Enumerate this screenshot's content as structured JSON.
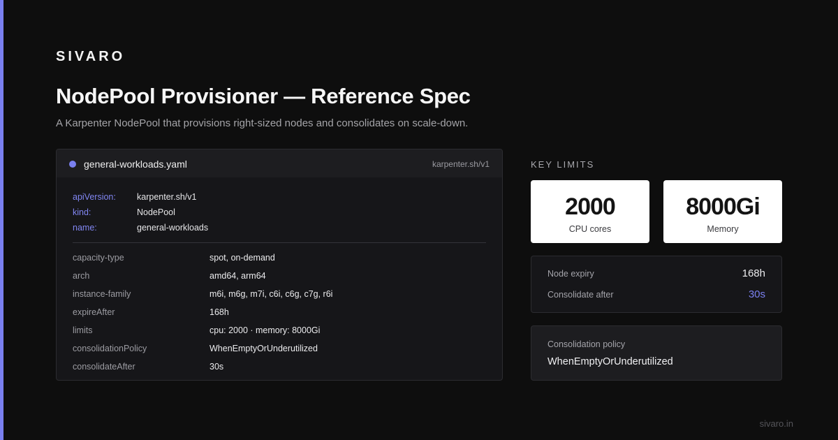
{
  "brand": "SIVARO",
  "title": "NodePool Provisioner — Reference Spec",
  "subtitle": "A Karpenter NodePool that provisions right-sized nodes and consolidates on scale-down.",
  "spec": {
    "file_name": "general-workloads.yaml",
    "api_tag": "karpenter.sh/v1",
    "meta": [
      {
        "key": "apiVersion:",
        "value": "karpenter.sh/v1"
      },
      {
        "key": "kind:",
        "value": "NodePool"
      },
      {
        "key": "name:",
        "value": "general-workloads"
      }
    ],
    "rows": [
      {
        "key": "capacity-type",
        "value": "spot, on-demand"
      },
      {
        "key": "arch",
        "value": "amd64, arm64"
      },
      {
        "key": "instance-family",
        "value": "m6i, m6g, m7i, c6i, c6g, c7g, r6i"
      },
      {
        "key": "expireAfter",
        "value": "168h"
      },
      {
        "key": "limits",
        "value": "cpu: 2000 · memory: 8000Gi"
      },
      {
        "key": "consolidationPolicy",
        "value": "WhenEmptyOrUnderutilized"
      },
      {
        "key": "consolidateAfter",
        "value": "30s"
      }
    ]
  },
  "limits": {
    "label": "KEY LIMITS",
    "stats": [
      {
        "value": "2000",
        "label": "CPU cores"
      },
      {
        "value": "8000Gi",
        "label": "Memory"
      }
    ],
    "info": [
      {
        "key": "Node expiry",
        "value": "168h"
      },
      {
        "key": "Consolidate after",
        "value": "30s"
      }
    ],
    "policy_label": "Consolidation policy",
    "policy_value": "WhenEmptyOrUnderutilized"
  },
  "footer_url": "sivaro.in",
  "colors": {
    "accent": "#7a80f0",
    "background": "#0e0e0e",
    "card": "#161619"
  }
}
